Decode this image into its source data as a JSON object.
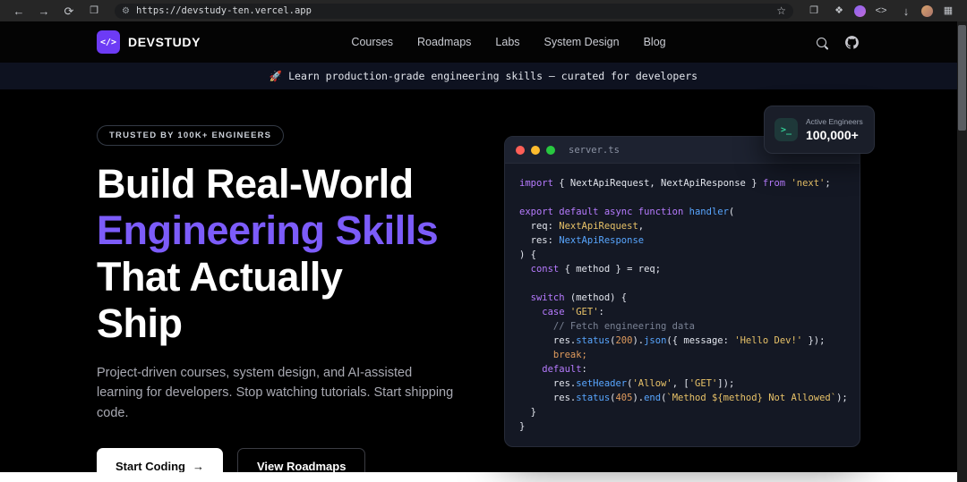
{
  "browser": {
    "url": "https://devstudy-ten.vercel.app",
    "icons": {
      "back": "←",
      "forward": "→",
      "reload": "⟳",
      "reading_list": "❒",
      "site_info": "⚙",
      "bookmark_star": "☆",
      "side_panel": "❐",
      "extensions": "❖",
      "code": "<>",
      "download": "↓",
      "apps": "▦"
    }
  },
  "site_header": {
    "logo_glyph": "</>",
    "logo_text": "DEVSTUDY",
    "nav": [
      "Courses",
      "Roadmaps",
      "Labs",
      "System Design",
      "Blog"
    ]
  },
  "announcement": {
    "text": "🚀 Learn production-grade engineering skills — curated for developers"
  },
  "hero": {
    "badge": "TRUSTED BY 100K+ ENGINEERS",
    "heading_lines": [
      {
        "text": "Build Real-World",
        "accent": false
      },
      {
        "text": "Engineering Skills",
        "accent": true
      },
      {
        "text": "That Actually",
        "accent": false
      },
      {
        "text": "Ship",
        "accent": false
      }
    ],
    "description": "Project-driven courses, system design, and AI-assisted learning for developers. Stop watching tutorials. Start shipping code.",
    "primary_cta": "Start Coding",
    "primary_cta_arrow": "→",
    "secondary_cta": "View Roadmaps"
  },
  "stat_card": {
    "icon_glyph": ">_",
    "label": "Active Engineers",
    "value": "100,000+"
  },
  "code_editor": {
    "filename": "server.ts",
    "lines": [
      [
        {
          "t": "kw",
          "s": "import "
        },
        {
          "t": "pl",
          "s": "{ NextApiRequest, NextApiResponse } "
        },
        {
          "t": "kw",
          "s": "from "
        },
        {
          "t": "str",
          "s": "'next'"
        },
        {
          "t": "pl",
          "s": ";"
        }
      ],
      [],
      [
        {
          "t": "kw",
          "s": "export default async function "
        },
        {
          "t": "fn",
          "s": "handler"
        },
        {
          "t": "pl",
          "s": "("
        }
      ],
      [
        {
          "t": "pl",
          "s": "  req: "
        },
        {
          "t": "type",
          "s": "NextApiRequest"
        },
        {
          "t": "pl",
          "s": ","
        }
      ],
      [
        {
          "t": "pl",
          "s": "  res: "
        },
        {
          "t": "fn",
          "s": "NextApiResponse"
        }
      ],
      [
        {
          "t": "pl",
          "s": ") {"
        }
      ],
      [
        {
          "t": "kw",
          "s": "  const "
        },
        {
          "t": "pl",
          "s": "{ method } = req;"
        }
      ],
      [],
      [
        {
          "t": "kw",
          "s": "  switch "
        },
        {
          "t": "pl",
          "s": "(method) {"
        }
      ],
      [
        {
          "t": "kw",
          "s": "    case "
        },
        {
          "t": "str",
          "s": "'GET'"
        },
        {
          "t": "pl",
          "s": ":"
        }
      ],
      [
        {
          "t": "cm",
          "s": "      // Fetch engineering data"
        }
      ],
      [
        {
          "t": "pl",
          "s": "      res."
        },
        {
          "t": "fn",
          "s": "status"
        },
        {
          "t": "pl",
          "s": "("
        },
        {
          "t": "num",
          "s": "200"
        },
        {
          "t": "pl",
          "s": ")."
        },
        {
          "t": "fn",
          "s": "json"
        },
        {
          "t": "pl",
          "s": "({ message: "
        },
        {
          "t": "str",
          "s": "'Hello Dev!'"
        },
        {
          "t": "pl",
          "s": " });"
        }
      ],
      [
        {
          "t": "ctrl",
          "s": "      break;"
        }
      ],
      [
        {
          "t": "kw",
          "s": "    default"
        },
        {
          "t": "pl",
          "s": ":"
        }
      ],
      [
        {
          "t": "pl",
          "s": "      res."
        },
        {
          "t": "fn",
          "s": "setHeader"
        },
        {
          "t": "pl",
          "s": "("
        },
        {
          "t": "str",
          "s": "'Allow'"
        },
        {
          "t": "pl",
          "s": ", ["
        },
        {
          "t": "str",
          "s": "'GET'"
        },
        {
          "t": "pl",
          "s": "]);"
        }
      ],
      [
        {
          "t": "pl",
          "s": "      res."
        },
        {
          "t": "fn",
          "s": "status"
        },
        {
          "t": "pl",
          "s": "("
        },
        {
          "t": "num",
          "s": "405"
        },
        {
          "t": "pl",
          "s": ")."
        },
        {
          "t": "fn",
          "s": "end"
        },
        {
          "t": "pl",
          "s": "("
        },
        {
          "t": "str",
          "s": "`Method ${method} Not Allowed`"
        },
        {
          "t": "pl",
          "s": ");"
        }
      ],
      [
        {
          "t": "pl",
          "s": "  }"
        }
      ],
      [
        {
          "t": "pl",
          "s": "}"
        }
      ]
    ]
  },
  "colors": {
    "accent_purple": "#7c5cfa",
    "logo_purple": "#6d3bf5",
    "stat_green": "#34d399",
    "announcement_bg": "#0e1220",
    "code_bg": "#141824"
  }
}
